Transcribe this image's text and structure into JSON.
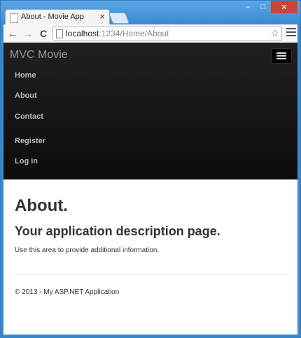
{
  "browser": {
    "tab_title": "About - Movie App",
    "tab_close": "×",
    "address": {
      "host": "localhost",
      "path": ":1234/Home/About"
    },
    "back": "←",
    "forward": "→",
    "reload": "C",
    "star": "☆",
    "window_controls": {
      "minimize": "–",
      "maximize": "□",
      "close": "✕"
    }
  },
  "navbar": {
    "brand": "MVC Movie",
    "links": [
      "Home",
      "About",
      "Contact",
      "Register",
      "Log in"
    ]
  },
  "main": {
    "title": "About.",
    "subtitle": "Your application description page.",
    "description": "Use this area to provide additional information."
  },
  "footer": {
    "text": "© 2013 - My ASP.NET Application"
  }
}
